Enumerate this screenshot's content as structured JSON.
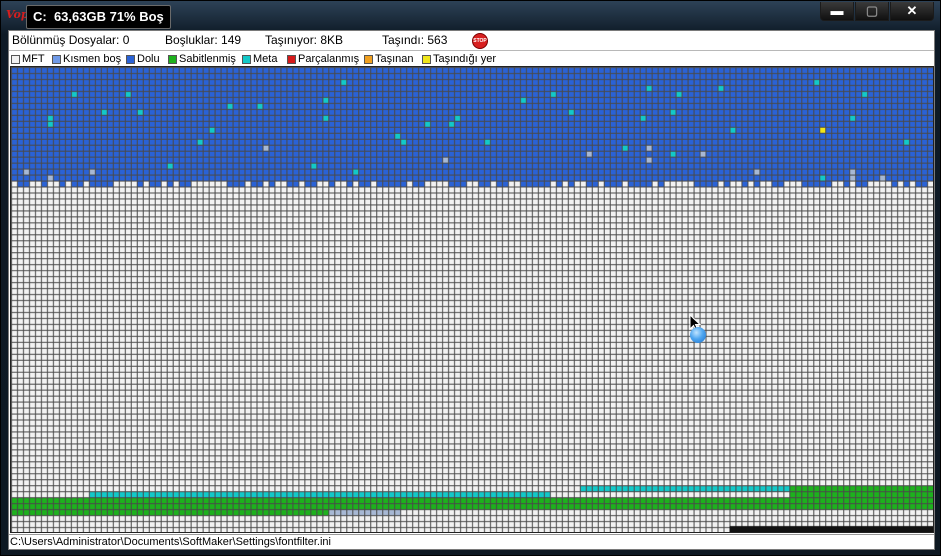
{
  "window": {
    "logo_text": "Vopt",
    "title": "C:  63,63GB 71% Boş",
    "controls": {
      "minimize": "▬",
      "restore": "▢",
      "close": "✕"
    }
  },
  "stats": {
    "fragmented_files": "Bölünmüş Dosyalar: 0",
    "gaps": "Boşluklar: 149",
    "moving": "Taşınıyor: 8KB",
    "moved": "Taşındı: 563",
    "stop_label": "STOP"
  },
  "legend": [
    {
      "label": "MFT",
      "color": "#f2f2f2"
    },
    {
      "label": "Kısmen boş",
      "color": "#6f9ae8"
    },
    {
      "label": "Dolu",
      "color": "#2a62d6"
    },
    {
      "label": "Sabitlenmiş",
      "color": "#1db11d"
    },
    {
      "label": "Meta",
      "color": "#12c9c9"
    },
    {
      "label": "Parçalanmış",
      "color": "#d61a1a"
    },
    {
      "label": "Taşınan",
      "color": "#f0a020"
    },
    {
      "label": "Taşındığı yer",
      "color": "#f0e61a"
    }
  ],
  "status_path": "C:\\Users\\Administrator\\Documents\\SoftMaker\\Settings\\fontfilter.ini",
  "colors": {
    "empty": "#f2f2f2",
    "used": "#2a62d6",
    "partial": "#a7b8d4",
    "meta": "#12c9c9",
    "pinned": "#1db11d",
    "moving": "#f0e61a",
    "grid": "#4a4a4a"
  }
}
